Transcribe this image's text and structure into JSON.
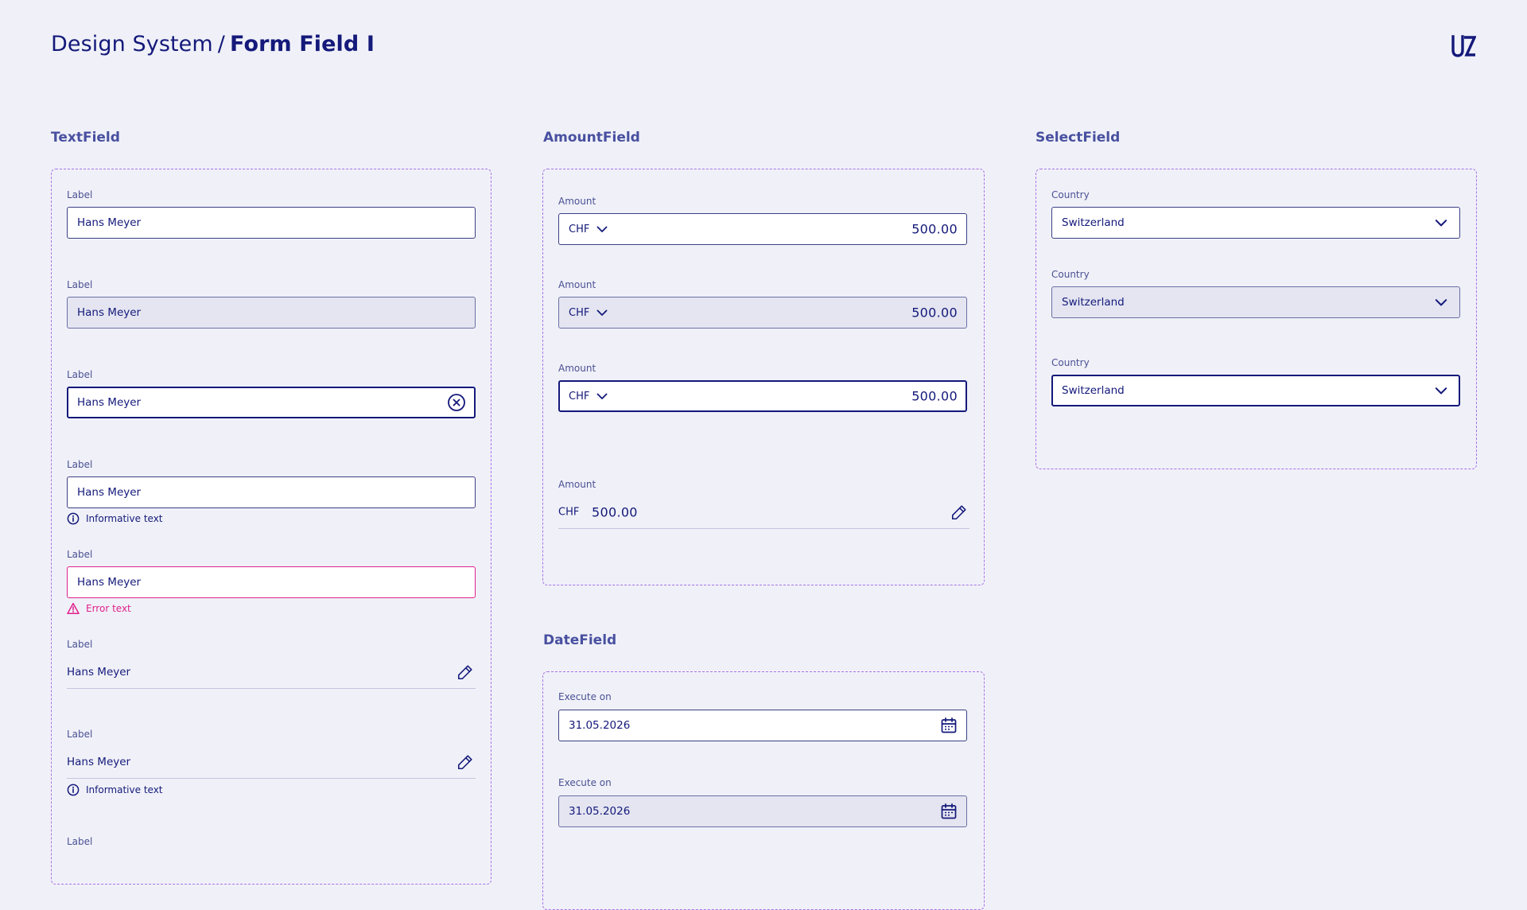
{
  "header": {
    "title_prefix": "Design System",
    "title_separator": "/",
    "title_main": "Form Field I",
    "logo_text": "UZ"
  },
  "textfield": {
    "section_title": "TextField",
    "fields": [
      {
        "label": "Label",
        "value": "Hans Meyer",
        "state": "default"
      },
      {
        "label": "Label",
        "value": "Hans Meyer",
        "state": "disabled"
      },
      {
        "label": "Label",
        "value": "Hans Meyer",
        "state": "focused",
        "icon": "clear-icon"
      },
      {
        "label": "Label",
        "value": "Hans Meyer",
        "state": "default",
        "helper": "Informative text",
        "helper_icon": "info-icon"
      },
      {
        "label": "Label",
        "value": "Hans Meyer",
        "state": "error",
        "helper": "Error text",
        "helper_icon": "warning-icon"
      },
      {
        "label": "Label",
        "value": "Hans Meyer",
        "state": "readonly",
        "icon": "pencil-icon"
      },
      {
        "label": "Label",
        "value": "Hans Meyer",
        "state": "readonly",
        "icon": "pencil-icon",
        "helper": "Informative text",
        "helper_icon": "info-icon"
      },
      {
        "label": "Label"
      }
    ]
  },
  "amountfield": {
    "section_title": "AmountField",
    "fields": [
      {
        "label": "Amount",
        "currency": "CHF",
        "value": "500.00",
        "state": "default"
      },
      {
        "label": "Amount",
        "currency": "CHF",
        "value": "500.00",
        "state": "disabled"
      },
      {
        "label": "Amount",
        "currency": "CHF",
        "value": "500.00",
        "state": "focused"
      },
      {
        "label": "Amount",
        "currency": "CHF",
        "value": "500.00",
        "state": "readonly",
        "icon": "pencil-icon"
      }
    ]
  },
  "datefield": {
    "section_title": "DateField",
    "fields": [
      {
        "label": "Execute on",
        "value": "31.05.2026",
        "state": "default",
        "icon": "calendar-icon"
      },
      {
        "label": "Execute on",
        "value": "31.05.2026",
        "state": "disabled",
        "icon": "calendar-icon"
      }
    ]
  },
  "selectfield": {
    "section_title": "SelectField",
    "fields": [
      {
        "label": "Country",
        "value": "Switzerland",
        "state": "default",
        "icon": "chevron-down-icon"
      },
      {
        "label": "Country",
        "value": "Switzerland",
        "state": "disabled",
        "icon": "chevron-down-icon"
      },
      {
        "label": "Country",
        "value": "Switzerland",
        "state": "focused",
        "icon": "chevron-down-icon"
      }
    ]
  },
  "colors": {
    "primary": "#14197a",
    "background": "#f0f1f8",
    "section_title": "#4850a0",
    "dashed_border": "#a871e6",
    "error": "#e0208c",
    "disabled_fill": "#e4e5f1"
  }
}
